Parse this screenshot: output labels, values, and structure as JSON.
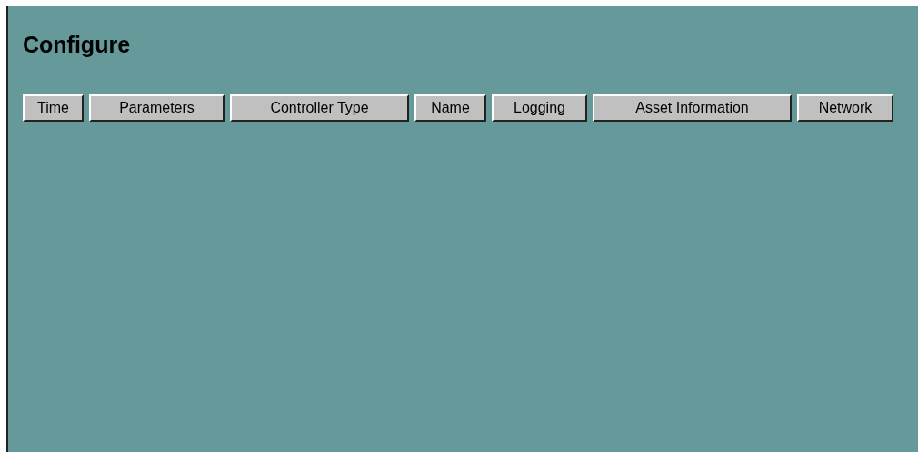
{
  "title": "Configure",
  "buttons": [
    {
      "label": "Time"
    },
    {
      "label": "Parameters"
    },
    {
      "label": "Controller Type"
    },
    {
      "label": "Name"
    },
    {
      "label": "Logging"
    },
    {
      "label": "Asset Information"
    },
    {
      "label": "Network"
    }
  ]
}
